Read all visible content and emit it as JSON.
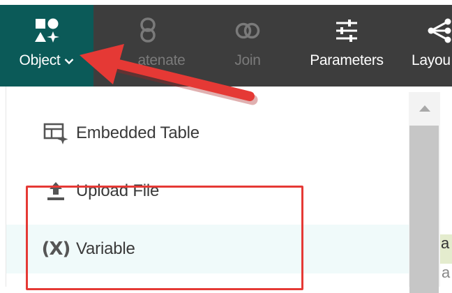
{
  "toolbar": {
    "items": [
      {
        "label": "Object",
        "icon": "shapes-icon",
        "active": true,
        "has_dropdown": true
      },
      {
        "label": "atenate",
        "icon": "concatenate-icon",
        "active": false,
        "disabled": true
      },
      {
        "label": "Join",
        "icon": "join-icon",
        "active": false,
        "disabled": true
      },
      {
        "label": "Parameters",
        "icon": "sliders-icon",
        "active": false
      },
      {
        "label": "Layou",
        "icon": "network-icon",
        "active": false
      }
    ]
  },
  "dropdown": {
    "items": [
      {
        "label": "Embedded Table",
        "icon": "embedded-table-icon"
      },
      {
        "label": "Upload File",
        "icon": "upload-icon"
      },
      {
        "label": "Variable",
        "icon": "variable-icon",
        "glyph": "(X)"
      }
    ]
  },
  "background": {
    "right_text": "a",
    "right_faint_text": "a"
  },
  "colors": {
    "toolbar_bg": "#3d3d3d",
    "active_bg": "#0b5a58",
    "annotation_red": "#e53935",
    "hover_row": "#f0fafa"
  }
}
